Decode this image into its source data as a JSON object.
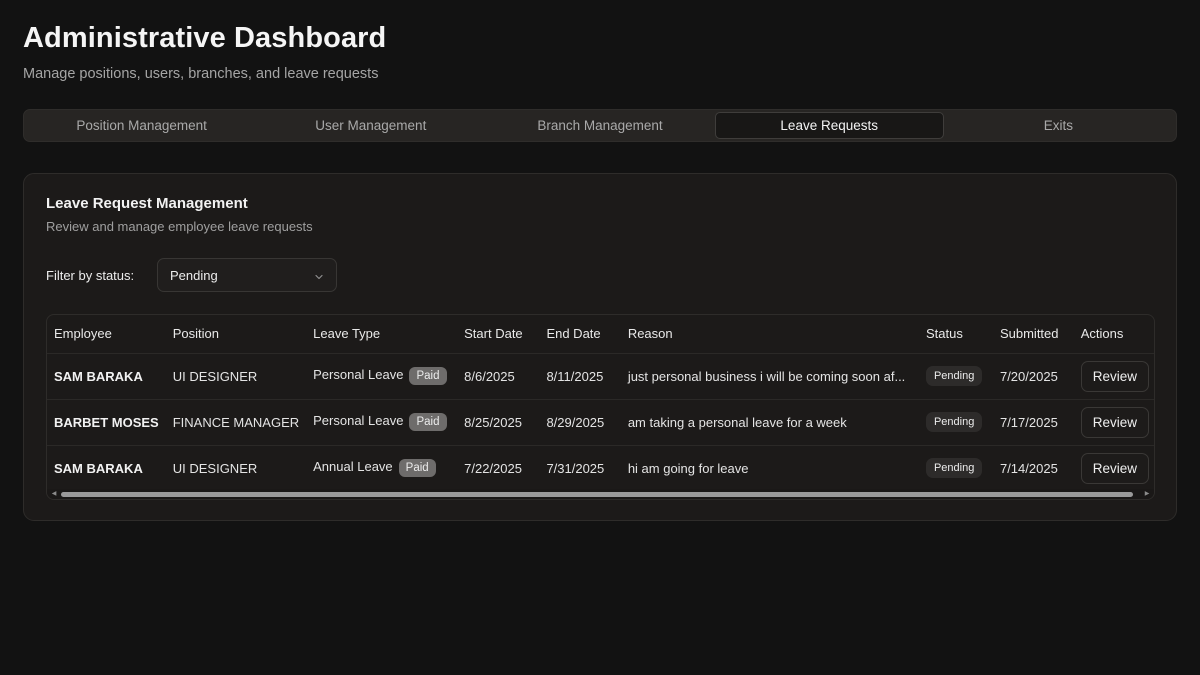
{
  "header": {
    "title": "Administrative Dashboard",
    "subtitle": "Manage positions, users, branches, and leave requests"
  },
  "tabs": [
    {
      "label": "Position Management",
      "active": false
    },
    {
      "label": "User Management",
      "active": false
    },
    {
      "label": "Branch Management",
      "active": false
    },
    {
      "label": "Leave Requests",
      "active": true
    },
    {
      "label": "Exits",
      "active": false
    }
  ],
  "card": {
    "title": "Leave Request Management",
    "description": "Review and manage employee leave requests",
    "filter_label": "Filter by status:",
    "filter_value": "Pending"
  },
  "table": {
    "columns": [
      "Employee",
      "Position",
      "Leave Type",
      "Start Date",
      "End Date",
      "Reason",
      "Status",
      "Submitted",
      "Actions"
    ],
    "rows": [
      {
        "employee": "SAM BARAKA",
        "position": "UI DESIGNER",
        "leave_type": "Personal Leave",
        "pay": "Paid",
        "start": "8/6/2025",
        "end": "8/11/2025",
        "reason": "just personal business i will be coming soon af...",
        "status": "Pending",
        "submitted": "7/20/2025",
        "action": "Review"
      },
      {
        "employee": "BARBET MOSES",
        "position": "FINANCE MANAGER",
        "leave_type": "Personal Leave",
        "pay": "Paid",
        "start": "8/25/2025",
        "end": "8/29/2025",
        "reason": "am taking a personal leave for a week",
        "status": "Pending",
        "submitted": "7/17/2025",
        "action": "Review"
      },
      {
        "employee": "SAM BARAKA",
        "position": "UI DESIGNER",
        "leave_type": "Annual Leave",
        "pay": "Paid",
        "start": "7/22/2025",
        "end": "7/31/2025",
        "reason": "hi am going for leave",
        "status": "Pending",
        "submitted": "7/14/2025",
        "action": "Review"
      }
    ]
  },
  "icons": {
    "select_chevron": "chevron-down-icon",
    "scroll_left": "scroll-left-arrow-icon",
    "scroll_right": "scroll-right-arrow-icon"
  }
}
